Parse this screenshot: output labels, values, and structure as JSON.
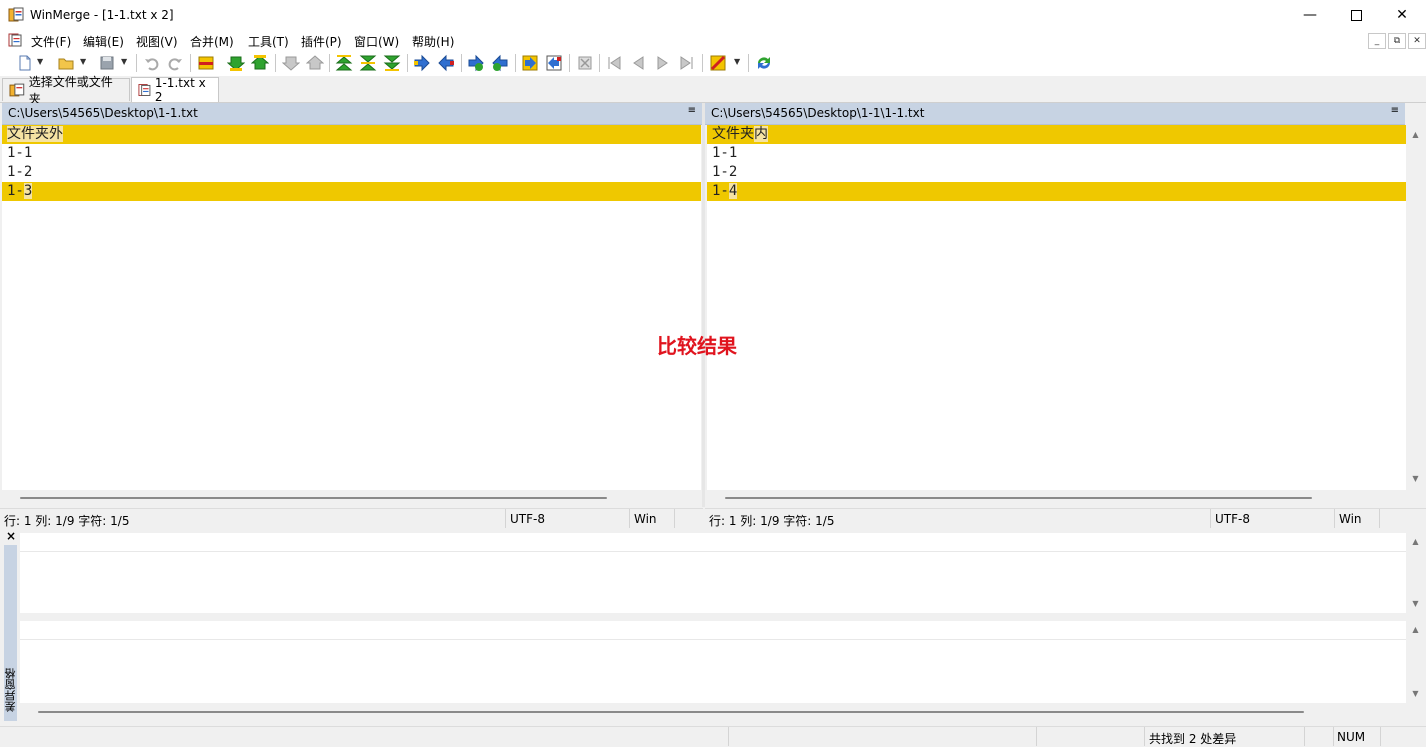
{
  "window": {
    "title": "WinMerge - [1-1.txt x 2]"
  },
  "menu": [
    "文件(F)",
    "编辑(E)",
    "视图(V)",
    "合并(M)",
    "工具(T)",
    "插件(P)",
    "窗口(W)",
    "帮助(H)"
  ],
  "tabs": [
    {
      "label": "选择文件或文件夹",
      "active": false
    },
    {
      "label": "1-1.txt x 2",
      "active": true
    }
  ],
  "left": {
    "path": "C:\\Users\\54565\\Desktop\\1-1.txt",
    "menu_glyph": "≡",
    "lines": [
      {
        "pre": "",
        "hl": "文件夹外",
        "post": "",
        "diff": true
      },
      {
        "pre": "1-1",
        "hl": "",
        "post": "",
        "diff": false
      },
      {
        "pre": "1-2",
        "hl": "",
        "post": "",
        "diff": false
      },
      {
        "pre": "1-",
        "hl": "3",
        "post": "",
        "diff": true
      }
    ],
    "status": {
      "pos": "行: 1  列: 1/9  字符: 1/5",
      "encoding": "UTF-8",
      "eol": "Win"
    }
  },
  "right": {
    "path": "C:\\Users\\54565\\Desktop\\1-1\\1-1.txt",
    "menu_glyph": "≡",
    "lines": [
      {
        "pre": "文件夹",
        "hl": "内",
        "post": "",
        "diff": true
      },
      {
        "pre": "1-1",
        "hl": "",
        "post": "",
        "diff": false
      },
      {
        "pre": "1-2",
        "hl": "",
        "post": "",
        "diff": false
      },
      {
        "pre": "1-",
        "hl": "4",
        "post": "",
        "diff": true
      }
    ],
    "status": {
      "pos": "行: 1  列: 1/9  字符: 1/5",
      "encoding": "UTF-8",
      "eol": "Win"
    }
  },
  "diff_pane": {
    "close_glyph": "×",
    "label": "差异窗格"
  },
  "statusbar": {
    "differences": "共找到 2 处差异",
    "num": "NUM"
  },
  "annotation": {
    "text": "比较结果"
  },
  "colors": {
    "diff": "#efc800",
    "diff_word": "#f5e3a3",
    "header": "#c7d3e3",
    "annotation": "#e0141e"
  }
}
